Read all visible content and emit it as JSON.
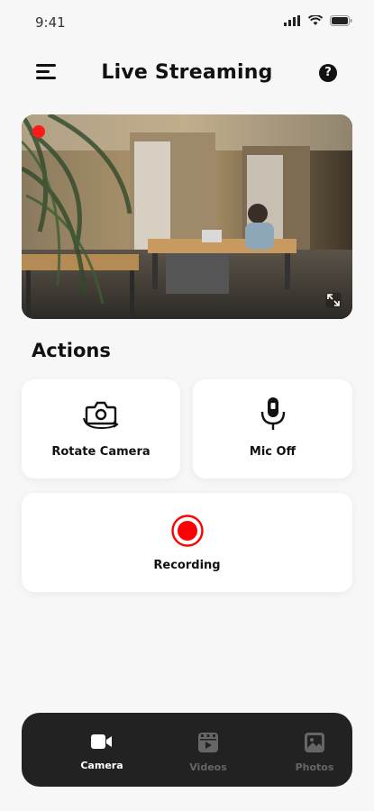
{
  "status_bar": {
    "time": "9:41"
  },
  "header": {
    "title": "Live Streaming",
    "help_icon": "help-circle-icon",
    "menu_icon": "menu-icon"
  },
  "camera": {
    "recording_indicator": "recording-dot",
    "expand_icon": "expand-icon"
  },
  "actions": {
    "title": "Actions",
    "rotate_camera": "Rotate Camera",
    "mic_off": "Mic Off",
    "recording": "Recording"
  },
  "colors": {
    "accent": "#ff0000",
    "nav_bg": "#222222",
    "active": "#ffffff",
    "inactive": "#666666"
  },
  "bottom_nav": {
    "items": [
      {
        "label": "Camera",
        "icon": "video-camera-icon",
        "active": true
      },
      {
        "label": "Videos",
        "icon": "film-icon",
        "active": false
      },
      {
        "label": "Photos",
        "icon": "image-icon",
        "active": false
      }
    ]
  }
}
